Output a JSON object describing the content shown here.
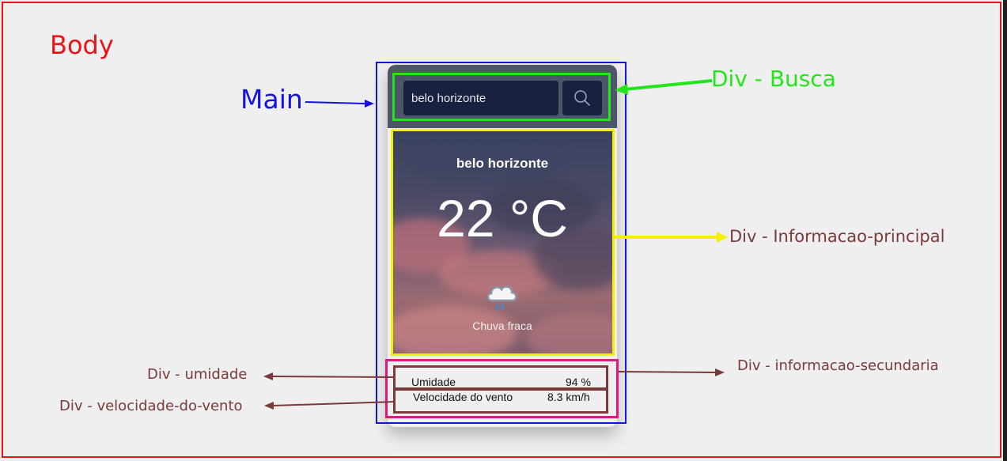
{
  "annotations": {
    "body": "Body",
    "main": "Main",
    "busca": "Div - Busca",
    "informacao_principal": "Div  - Informacao-principal",
    "informacao_secundaria": "Div - informacao-secundaria",
    "umidade": "Div  - umidade",
    "velocidade_do_vento": "Div - velocidade-do-vento"
  },
  "search": {
    "value": "belo horizonte",
    "icon": "search-icon"
  },
  "weather": {
    "city": "belo horizonte",
    "temperature": "22 °C",
    "icon": "rain-cloud-icon",
    "description": "Chuva fraca"
  },
  "details": {
    "humidity_label": "Umidade",
    "humidity_value": "94 %",
    "wind_label": "Velocidade do vento",
    "wind_value": "8.3 km/h"
  },
  "colors": {
    "body_outline": "#e8141b",
    "main_outline": "#1411e6",
    "busca_outline": "#22e61a",
    "info_principal_outline": "#f5ef00",
    "info_secundaria_outline": "#e0187f",
    "row_outline": "#7b3a3a"
  }
}
